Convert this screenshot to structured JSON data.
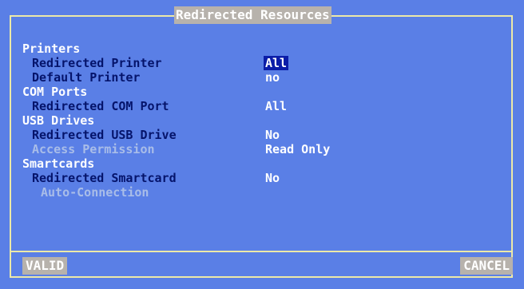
{
  "dialog": {
    "title": "Redirected Resources"
  },
  "sections": {
    "printers": {
      "header": "Printers",
      "redirected_printer": {
        "label": "Redirected Printer",
        "value": "All"
      },
      "default_printer": {
        "label": "Default Printer",
        "value": "no"
      }
    },
    "com_ports": {
      "header": "COM Ports",
      "redirected_com_port": {
        "label": "Redirected COM Port",
        "value": "All"
      }
    },
    "usb_drives": {
      "header": "USB Drives",
      "redirected_usb_drive": {
        "label": "Redirected USB Drive",
        "value": "No"
      },
      "access_permission": {
        "label": "Access Permission",
        "value": "Read Only"
      }
    },
    "smartcards": {
      "header": "Smartcards",
      "redirected_smartcard": {
        "label": "Redirected Smartcard",
        "value": "No"
      },
      "auto_connection": {
        "label": "Auto-Connection"
      }
    }
  },
  "buttons": {
    "valid": "VALID",
    "cancel": "CANCEL"
  },
  "colors": {
    "background": "#5a7fe6",
    "frame": "#ece9a8",
    "label": "#05146b",
    "disabled_label": "#a9bde8",
    "selection": "#0b1da8",
    "button_bg": "#b7b2ac"
  }
}
